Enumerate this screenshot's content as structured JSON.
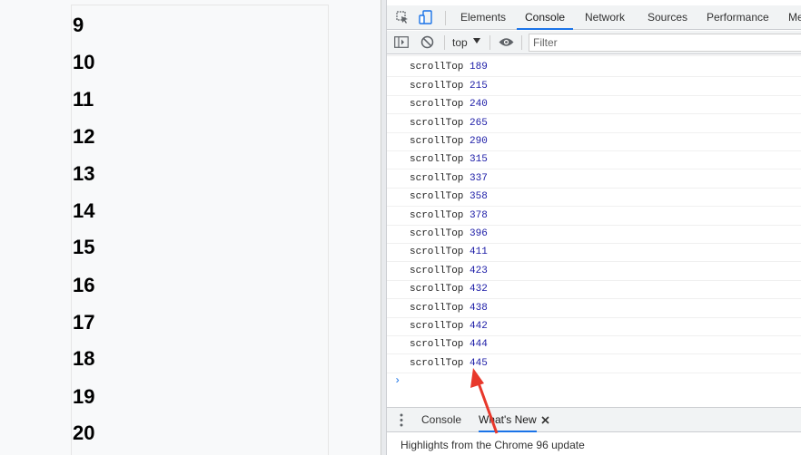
{
  "page": {
    "numbers": [
      "9",
      "10",
      "11",
      "12",
      "13",
      "14",
      "15",
      "16",
      "17",
      "18",
      "19",
      "20"
    ]
  },
  "devtools": {
    "tabs": [
      "Elements",
      "Console",
      "Network",
      "Sources",
      "Performance",
      "Me"
    ],
    "active_tab": "Console",
    "toolbar": {
      "context": "top",
      "filter_placeholder": "Filter"
    },
    "logs": [
      {
        "label": "scrollTop",
        "value": "189"
      },
      {
        "label": "scrollTop",
        "value": "215"
      },
      {
        "label": "scrollTop",
        "value": "240"
      },
      {
        "label": "scrollTop",
        "value": "265"
      },
      {
        "label": "scrollTop",
        "value": "290"
      },
      {
        "label": "scrollTop",
        "value": "315"
      },
      {
        "label": "scrollTop",
        "value": "337"
      },
      {
        "label": "scrollTop",
        "value": "358"
      },
      {
        "label": "scrollTop",
        "value": "378"
      },
      {
        "label": "scrollTop",
        "value": "396"
      },
      {
        "label": "scrollTop",
        "value": "411"
      },
      {
        "label": "scrollTop",
        "value": "423"
      },
      {
        "label": "scrollTop",
        "value": "432"
      },
      {
        "label": "scrollTop",
        "value": "438"
      },
      {
        "label": "scrollTop",
        "value": "442"
      },
      {
        "label": "scrollTop",
        "value": "444"
      },
      {
        "label": "scrollTop",
        "value": "445"
      }
    ],
    "prompt": "›",
    "drawer": {
      "tabs": [
        "Console",
        "What's New"
      ],
      "active_tab": "What's New",
      "message": "Highlights from the Chrome 96 update"
    }
  },
  "colors": {
    "accent": "#1a73e8",
    "log_value": "#1a1aa6",
    "annotation_arrow": "#e8382b"
  },
  "icons": [
    "inspect-icon",
    "device-toggle-icon",
    "sidebar-toggle-icon",
    "clear-console-icon",
    "dropdown-arrow-icon",
    "eye-icon",
    "more-vert-icon",
    "close-icon"
  ]
}
